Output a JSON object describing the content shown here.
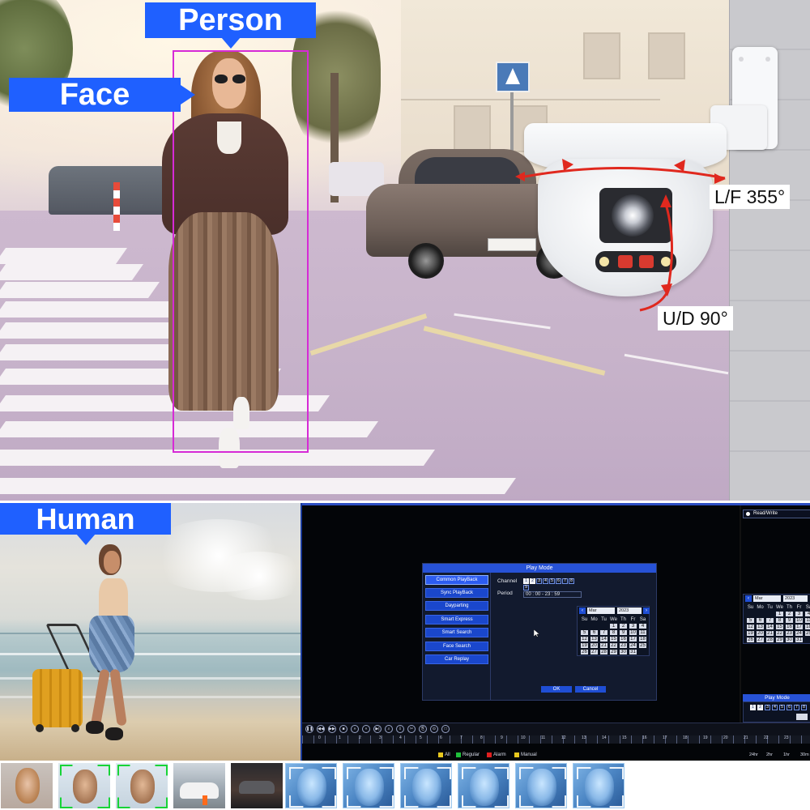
{
  "labels": {
    "person": "Person",
    "face": "Face",
    "human": "Human",
    "pan": "L/F 355°",
    "tilt": "U/D 90°"
  },
  "colors": {
    "tag_blue": "#1f60ff",
    "box_magenta": "#d62ad6",
    "rotation_arrow": "#e0281e",
    "dvr_blue": "#2752d6"
  },
  "dvr": {
    "play_mode_title": "Play Mode",
    "menu": [
      "Common PlayBack",
      "Sync PlayBack",
      "Dayparting",
      "Smart Express",
      "Smart Search",
      "Face Search",
      "Car Replay"
    ],
    "active_menu_index": 0,
    "channel_label": "Channel",
    "channels": [
      "1",
      "2",
      "3",
      "4",
      "5",
      "6",
      "7",
      "8",
      "9"
    ],
    "channels_checked": [
      "1",
      "2"
    ],
    "period_label": "Period",
    "period_value": "00 : 00   -   23 : 59",
    "calendar": {
      "month": "Mar",
      "year": "2023",
      "weekdays": [
        "Su",
        "Mo",
        "Tu",
        "We",
        "Th",
        "Fr",
        "Sa"
      ],
      "first_weekday_index": 3,
      "days": 31
    },
    "ok_label": "OK",
    "cancel_label": "Cancel",
    "right_panel": {
      "drive_select": "Read/Write",
      "month": "Mar",
      "year": "2023",
      "play_mode": "Play Mode",
      "channels": [
        "1",
        "2",
        "3",
        "4",
        "5",
        "6",
        "7",
        "8"
      ]
    },
    "playback_icons": [
      "pause",
      "prev",
      "next",
      "stop",
      "fast",
      "slow",
      "frame",
      "search",
      "backup",
      "cut",
      "clip",
      "save",
      "square"
    ],
    "ruler_ticks": [
      "0",
      "1",
      "2",
      "3",
      "4",
      "5",
      "6",
      "7",
      "8",
      "9",
      "10",
      "11",
      "12",
      "13",
      "14",
      "15",
      "16",
      "17",
      "18",
      "19",
      "20",
      "21",
      "22",
      "23"
    ],
    "legend": [
      {
        "label": "All",
        "color": "#e8c81e"
      },
      {
        "label": "Regular",
        "color": "#1fbf3a"
      },
      {
        "label": "Alarm",
        "color": "#e01f1f"
      },
      {
        "label": "Manual",
        "color": "#e8c81e"
      }
    ],
    "zoom": [
      "24hr",
      "2hr",
      "1hr",
      "30m"
    ]
  },
  "thumbnails": [
    "woman",
    "man",
    "man",
    "car-t",
    "night",
    "face",
    "face",
    "face",
    "face",
    "face",
    "face"
  ]
}
